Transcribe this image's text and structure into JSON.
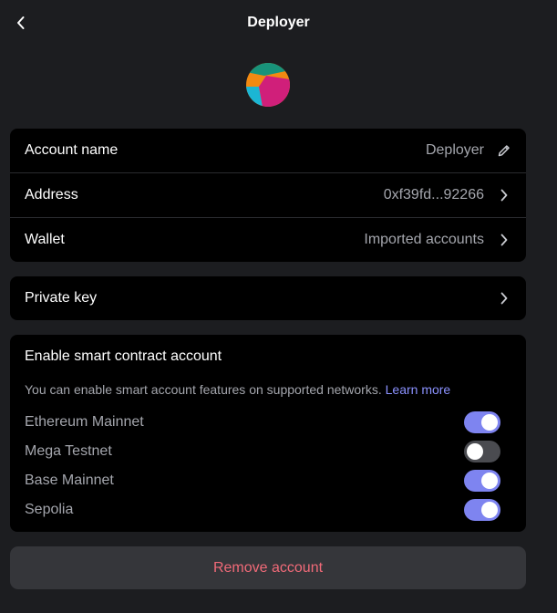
{
  "header": {
    "title": "Deployer"
  },
  "account": {
    "name_label": "Account name",
    "name_value": "Deployer",
    "address_label": "Address",
    "address_value": "0xf39fd...92266",
    "wallet_label": "Wallet",
    "wallet_value": "Imported accounts"
  },
  "private_key": {
    "label": "Private key"
  },
  "smart_account": {
    "title": "Enable smart contract account",
    "description": "You can enable smart account features on supported networks.",
    "learn_more": "Learn more",
    "networks": [
      {
        "name": "Ethereum Mainnet",
        "enabled": true
      },
      {
        "name": "Mega Testnet",
        "enabled": false
      },
      {
        "name": "Base Mainnet",
        "enabled": true
      },
      {
        "name": "Sepolia",
        "enabled": true
      }
    ]
  },
  "remove_button": {
    "label": "Remove account"
  },
  "colors": {
    "toggle_on": "#7e84f0",
    "toggle_off": "#4a4b50",
    "danger": "#f06a78",
    "link": "#8b92ff"
  }
}
